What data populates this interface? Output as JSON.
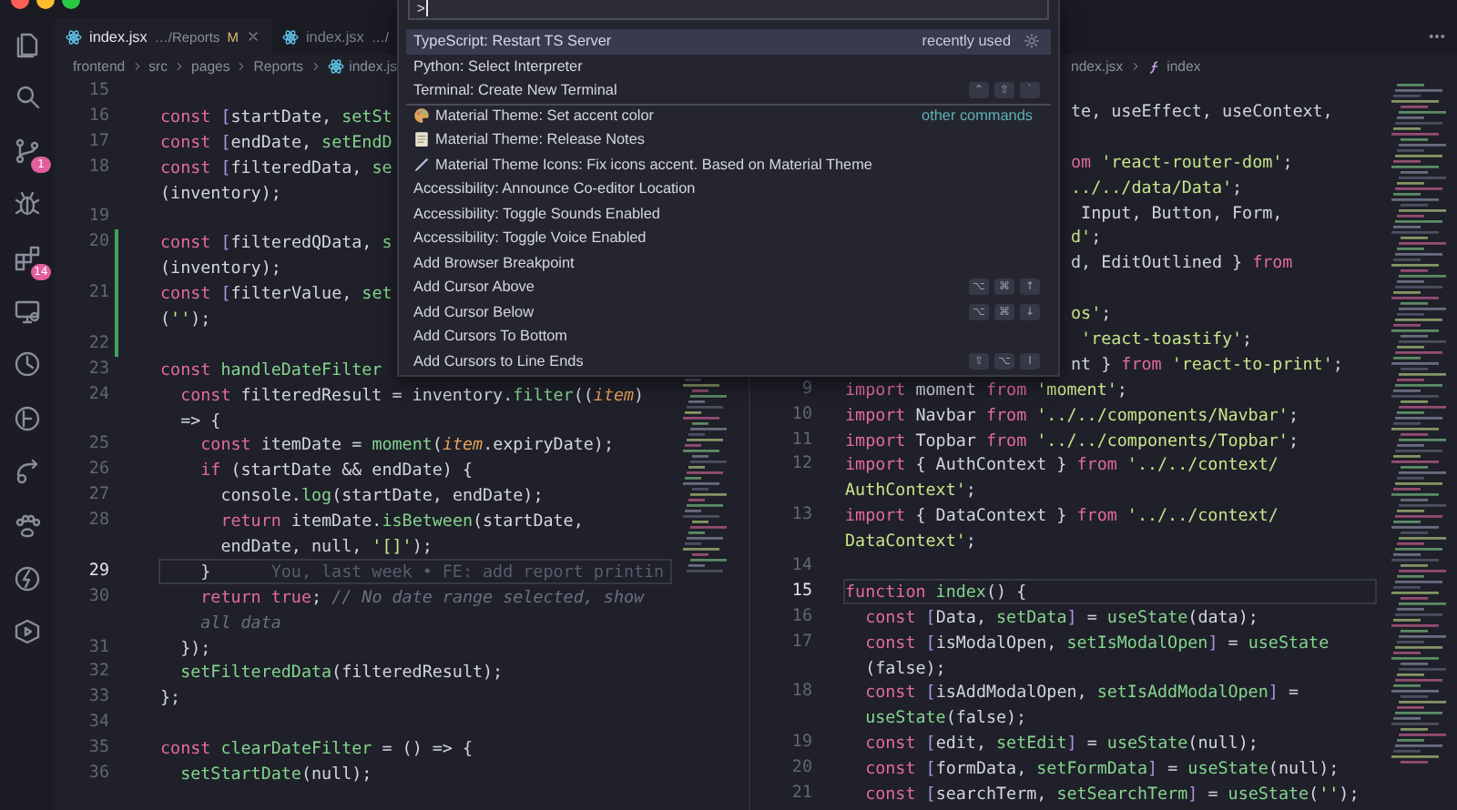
{
  "activity_bar": {
    "source_control_badge": "1",
    "extensions_badge": "14"
  },
  "left_editor": {
    "tabs": [
      {
        "label": "index.jsx",
        "path": "…/Reports",
        "badge": "M",
        "selected": true
      },
      {
        "label": "index.jsx",
        "path": "…/",
        "selected": false
      }
    ],
    "breadcrumb": [
      "frontend",
      "src",
      "pages",
      "Reports",
      "index.js"
    ],
    "lines": [
      {
        "num": "15"
      },
      {
        "num": "16",
        "segs": [
          {
            "kind": "kw",
            "text": "const "
          },
          {
            "kind": "br",
            "text": "["
          },
          {
            "kind": "var",
            "text": "startDate, "
          },
          {
            "kind": "fn",
            "text": "setSt"
          }
        ]
      },
      {
        "num": "17",
        "segs": [
          {
            "kind": "kw",
            "text": "const "
          },
          {
            "kind": "br",
            "text": "["
          },
          {
            "kind": "var",
            "text": "endDate, "
          },
          {
            "kind": "fn",
            "text": "setEndD"
          }
        ]
      },
      {
        "num": "18",
        "segs": [
          {
            "kind": "kw",
            "text": "const "
          },
          {
            "kind": "br",
            "text": "["
          },
          {
            "kind": "var",
            "text": "filteredData, "
          },
          {
            "kind": "fn",
            "text": "se"
          }
        ]
      },
      {
        "segs": [
          {
            "kind": "var",
            "text": "(inventory);"
          }
        ]
      },
      {
        "num": "19"
      },
      {
        "num": "20",
        "modified": true,
        "segs": [
          {
            "kind": "kw",
            "text": "const "
          },
          {
            "kind": "br",
            "text": "["
          },
          {
            "kind": "var",
            "text": "filteredQData, "
          },
          {
            "kind": "fn",
            "text": "s"
          }
        ]
      },
      {
        "modified": true,
        "segs": [
          {
            "kind": "var",
            "text": "(inventory);"
          }
        ]
      },
      {
        "num": "21",
        "modified": true,
        "segs": [
          {
            "kind": "kw",
            "text": "const "
          },
          {
            "kind": "br",
            "text": "["
          },
          {
            "kind": "var",
            "text": "filterValue, "
          },
          {
            "kind": "fn",
            "text": "set"
          }
        ]
      },
      {
        "modified": true,
        "segs": [
          {
            "kind": "var",
            "text": "("
          },
          {
            "kind": "str",
            "text": "''"
          },
          {
            "kind": "var",
            "text": ");"
          }
        ]
      },
      {
        "num": "22",
        "modified": true
      },
      {
        "num": "23",
        "segs": [
          {
            "kind": "kw",
            "text": "const "
          },
          {
            "kind": "fn",
            "text": "handleDateFilter"
          }
        ]
      },
      {
        "num": "24",
        "segs": [
          {
            "kind": "kw",
            "text": "  const "
          },
          {
            "kind": "var",
            "text": "filteredResult = inventory."
          },
          {
            "kind": "fn",
            "text": "filter"
          },
          {
            "kind": "var",
            "text": "(("
          },
          {
            "kind": "param",
            "text": "item"
          },
          {
            "kind": "var",
            "text": ")"
          }
        ]
      },
      {
        "segs": [
          {
            "kind": "var",
            "text": "  => {"
          }
        ]
      },
      {
        "num": "25",
        "segs": [
          {
            "kind": "kw",
            "text": "    const "
          },
          {
            "kind": "var",
            "text": "itemDate = "
          },
          {
            "kind": "fn",
            "text": "moment"
          },
          {
            "kind": "var",
            "text": "("
          },
          {
            "kind": "param",
            "text": "item"
          },
          {
            "kind": "var",
            "text": ".expiryDate);"
          }
        ]
      },
      {
        "num": "26",
        "segs": [
          {
            "kind": "kw",
            "text": "    if "
          },
          {
            "kind": "var",
            "text": "(startDate && endDate) {"
          }
        ]
      },
      {
        "num": "27",
        "segs": [
          {
            "kind": "var",
            "text": "      console."
          },
          {
            "kind": "fn",
            "text": "log"
          },
          {
            "kind": "var",
            "text": "(startDate, endDate);"
          }
        ]
      },
      {
        "num": "28",
        "segs": [
          {
            "kind": "kw",
            "text": "      return "
          },
          {
            "kind": "var",
            "text": "itemDate."
          },
          {
            "kind": "fn",
            "text": "isBetween"
          },
          {
            "kind": "var",
            "text": "(startDate,"
          }
        ]
      },
      {
        "segs": [
          {
            "kind": "var",
            "text": "      endDate, null, "
          },
          {
            "kind": "str",
            "text": "'[]'"
          },
          {
            "kind": "var",
            "text": ");"
          }
        ]
      },
      {
        "num": "29",
        "current": true,
        "segs": [
          {
            "kind": "var",
            "text": "    }"
          }
        ],
        "blame": "You, last week • FE: add report printin"
      },
      {
        "num": "30",
        "segs": [
          {
            "kind": "kw",
            "text": "    return true"
          },
          {
            "kind": "var",
            "text": "; "
          },
          {
            "kind": "cm",
            "text": "// No date range selected, show"
          }
        ]
      },
      {
        "segs": [
          {
            "kind": "cm",
            "text": "    all data"
          }
        ]
      },
      {
        "num": "31",
        "segs": [
          {
            "kind": "var",
            "text": "  });"
          }
        ]
      },
      {
        "num": "32",
        "segs": [
          {
            "kind": "fn",
            "text": "  setFilteredData"
          },
          {
            "kind": "var",
            "text": "(filteredResult);"
          }
        ]
      },
      {
        "num": "33",
        "segs": [
          {
            "kind": "var",
            "text": "};"
          }
        ]
      },
      {
        "num": "34"
      },
      {
        "num": "35",
        "segs": [
          {
            "kind": "kw",
            "text": "const "
          },
          {
            "kind": "fn",
            "text": "clearDateFilter"
          },
          {
            "kind": "var",
            "text": " = () => {"
          }
        ]
      },
      {
        "num": "36",
        "segs": [
          {
            "kind": "fn",
            "text": "  setStartDate"
          },
          {
            "kind": "var",
            "text": "(null);"
          }
        ]
      }
    ]
  },
  "right_editor": {
    "breadcrumb": [
      "ndex.jsx"
    ],
    "symbol": "index",
    "lines": [
      {
        "partly_hidden": true,
        "wraps": true,
        "segs": [
          {
            "kind": "var",
            "text": "te, useEffect, useContext,"
          }
        ]
      },
      {
        "partly_hidden": true,
        "segs": [
          {
            "kind": "kw",
            "text": "om "
          },
          {
            "kind": "str",
            "text": "'react-router-dom'"
          },
          {
            "kind": "var",
            "text": ";"
          }
        ]
      },
      {
        "partly_hidden": true,
        "segs": [
          {
            "kind": "str",
            "text": "../../data/Data'"
          },
          {
            "kind": "var",
            "text": ";"
          }
        ]
      },
      {
        "partly_hidden": true,
        "segs": [
          {
            "kind": "var",
            "text": " Input, Button, Form,"
          }
        ]
      },
      {
        "partly_hidden": true,
        "segs": [
          {
            "kind": "str",
            "text": "d'"
          },
          {
            "kind": "var",
            "text": ";"
          }
        ]
      },
      {
        "partly_hidden": true,
        "wraps": true,
        "segs": [
          {
            "kind": "var",
            "text": "d, EditOutlined } "
          },
          {
            "kind": "kw",
            "text": "from"
          }
        ]
      },
      {
        "partly_hidden": true,
        "segs": [
          {
            "kind": "str",
            "text": "os'"
          },
          {
            "kind": "var",
            "text": ";"
          }
        ]
      },
      {
        "partly_hidden": true,
        "segs": [
          {
            "kind": "str",
            "text": " 'react-toastify'"
          },
          {
            "kind": "var",
            "text": ";"
          }
        ]
      },
      {
        "partly_hidden": true,
        "segs": [
          {
            "kind": "var",
            "text": "nt } "
          },
          {
            "kind": "kw",
            "text": "from "
          },
          {
            "kind": "str",
            "text": "'react-to-print'"
          },
          {
            "kind": "var",
            "text": ";"
          }
        ]
      },
      {
        "num": "9",
        "segs": [
          {
            "kind": "kw",
            "text": "import "
          },
          {
            "kind": "var",
            "text": "moment "
          },
          {
            "kind": "kw",
            "text": "from "
          },
          {
            "kind": "str",
            "text": "'moment'"
          },
          {
            "kind": "var",
            "text": ";"
          }
        ]
      },
      {
        "num": "10",
        "segs": [
          {
            "kind": "kw",
            "text": "import "
          },
          {
            "kind": "var",
            "text": "Navbar "
          },
          {
            "kind": "kw",
            "text": "from "
          },
          {
            "kind": "str",
            "text": "'../../components/Navbar'"
          },
          {
            "kind": "var",
            "text": ";"
          }
        ]
      },
      {
        "num": "11",
        "segs": [
          {
            "kind": "kw",
            "text": "import "
          },
          {
            "kind": "var",
            "text": "Topbar "
          },
          {
            "kind": "kw",
            "text": "from "
          },
          {
            "kind": "str",
            "text": "'../../components/Topbar'"
          },
          {
            "kind": "var",
            "text": ";"
          }
        ]
      },
      {
        "num": "12",
        "segs": [
          {
            "kind": "kw",
            "text": "import "
          },
          {
            "kind": "var",
            "text": "{ AuthContext } "
          },
          {
            "kind": "kw",
            "text": "from "
          },
          {
            "kind": "str",
            "text": "'../../context/"
          }
        ]
      },
      {
        "segs": [
          {
            "kind": "str",
            "text": "AuthContext'"
          },
          {
            "kind": "var",
            "text": ";"
          }
        ]
      },
      {
        "num": "13",
        "segs": [
          {
            "kind": "kw",
            "text": "import "
          },
          {
            "kind": "var",
            "text": "{ DataContext } "
          },
          {
            "kind": "kw",
            "text": "from "
          },
          {
            "kind": "str",
            "text": "'../../context/"
          }
        ]
      },
      {
        "segs": [
          {
            "kind": "str",
            "text": "DataContext'"
          },
          {
            "kind": "var",
            "text": ";"
          }
        ]
      },
      {
        "num": "14"
      },
      {
        "num": "15",
        "current": true,
        "segs": [
          {
            "kind": "kw",
            "text": "function "
          },
          {
            "kind": "fn",
            "text": "index"
          },
          {
            "kind": "var",
            "text": "() {"
          }
        ]
      },
      {
        "num": "16",
        "segs": [
          {
            "kind": "kw",
            "text": "  const "
          },
          {
            "kind": "br",
            "text": "["
          },
          {
            "kind": "var",
            "text": "Data, "
          },
          {
            "kind": "fn",
            "text": "setData"
          },
          {
            "kind": "br",
            "text": "]"
          },
          {
            "kind": "var",
            "text": " = "
          },
          {
            "kind": "fn",
            "text": "useState"
          },
          {
            "kind": "var",
            "text": "(data);"
          }
        ]
      },
      {
        "num": "17",
        "segs": [
          {
            "kind": "kw",
            "text": "  const "
          },
          {
            "kind": "br",
            "text": "["
          },
          {
            "kind": "var",
            "text": "isModalOpen, "
          },
          {
            "kind": "fn",
            "text": "setIsModalOpen"
          },
          {
            "kind": "br",
            "text": "]"
          },
          {
            "kind": "var",
            "text": " = "
          },
          {
            "kind": "fn",
            "text": "useState"
          }
        ]
      },
      {
        "segs": [
          {
            "kind": "var",
            "text": "  (false);"
          }
        ]
      },
      {
        "num": "18",
        "segs": [
          {
            "kind": "kw",
            "text": "  const "
          },
          {
            "kind": "br",
            "text": "["
          },
          {
            "kind": "var",
            "text": "isAddModalOpen, "
          },
          {
            "kind": "fn",
            "text": "setIsAddModalOpen"
          },
          {
            "kind": "br",
            "text": "]"
          },
          {
            "kind": "var",
            "text": " ="
          }
        ]
      },
      {
        "segs": [
          {
            "kind": "fn",
            "text": "  useState"
          },
          {
            "kind": "var",
            "text": "(false);"
          }
        ]
      },
      {
        "num": "19",
        "segs": [
          {
            "kind": "kw",
            "text": "  const "
          },
          {
            "kind": "br",
            "text": "["
          },
          {
            "kind": "var",
            "text": "edit, "
          },
          {
            "kind": "fn",
            "text": "setEdit"
          },
          {
            "kind": "br",
            "text": "]"
          },
          {
            "kind": "var",
            "text": " = "
          },
          {
            "kind": "fn",
            "text": "useState"
          },
          {
            "kind": "var",
            "text": "(null);"
          }
        ]
      },
      {
        "num": "20",
        "segs": [
          {
            "kind": "kw",
            "text": "  const "
          },
          {
            "kind": "br",
            "text": "["
          },
          {
            "kind": "var",
            "text": "formData, "
          },
          {
            "kind": "fn",
            "text": "setFormData"
          },
          {
            "kind": "br",
            "text": "]"
          },
          {
            "kind": "var",
            "text": " = "
          },
          {
            "kind": "fn",
            "text": "useState"
          },
          {
            "kind": "var",
            "text": "(null);"
          }
        ]
      },
      {
        "num": "21",
        "segs": [
          {
            "kind": "kw",
            "text": "  const "
          },
          {
            "kind": "br",
            "text": "["
          },
          {
            "kind": "var",
            "text": "searchTerm, "
          },
          {
            "kind": "fn",
            "text": "setSearchTerm"
          },
          {
            "kind": "br",
            "text": "]"
          },
          {
            "kind": "var",
            "text": " = "
          },
          {
            "kind": "fn",
            "text": "useState"
          },
          {
            "kind": "var",
            "text": "("
          },
          {
            "kind": "str",
            "text": "''"
          },
          {
            "kind": "var",
            "text": ");"
          }
        ]
      }
    ]
  },
  "palette": {
    "input": ">",
    "items": [
      {
        "label": "TypeScript: Restart TS Server",
        "detail": "recently used",
        "divider_above": false,
        "kind": "command",
        "selected": true
      },
      {
        "label": "Python: Select Interpreter",
        "divider_above": false,
        "kind": "command",
        "selected": false
      },
      {
        "label": "Terminal: Create New Terminal",
        "divider_above": false,
        "kind": "command",
        "keys": [
          "⌃",
          "⇧",
          "`"
        ],
        "selected": false
      },
      {
        "label": "Material Theme: Set accent color",
        "detail": "other commands",
        "divider_above": true,
        "kind": "color",
        "selected": false
      },
      {
        "label": "Material Theme: Release Notes",
        "divider_above": false,
        "kind": "notes",
        "selected": false
      },
      {
        "label": "Material Theme Icons: Fix icons accent. Based on Material Theme",
        "divider_above": false,
        "kind": "icons",
        "selected": false
      },
      {
        "label": "Accessibility: Announce Co-editor Location",
        "divider_above": false,
        "kind": "command",
        "selected": false
      },
      {
        "label": "Accessibility: Toggle Sounds Enabled",
        "divider_above": false,
        "kind": "command",
        "selected": false
      },
      {
        "label": "Accessibility: Toggle Voice Enabled",
        "divider_above": false,
        "kind": "command",
        "selected": false
      },
      {
        "label": "Add Browser Breakpoint",
        "divider_above": false,
        "kind": "command",
        "selected": false
      },
      {
        "label": "Add Cursor Above",
        "divider_above": false,
        "kind": "command",
        "keys": [
          "⌥",
          "⌘",
          "↑"
        ],
        "selected": false
      },
      {
        "label": "Add Cursor Below",
        "divider_above": false,
        "kind": "command",
        "keys": [
          "⌥",
          "⌘",
          "↓"
        ],
        "selected": false
      },
      {
        "label": "Add Cursors To Bottom",
        "divider_above": false,
        "kind": "command",
        "selected": false
      },
      {
        "label": "Add Cursors to Line Ends",
        "divider_above": false,
        "kind": "command",
        "keys": [
          "⇧",
          "⌥",
          "I"
        ],
        "selected": false
      }
    ]
  }
}
